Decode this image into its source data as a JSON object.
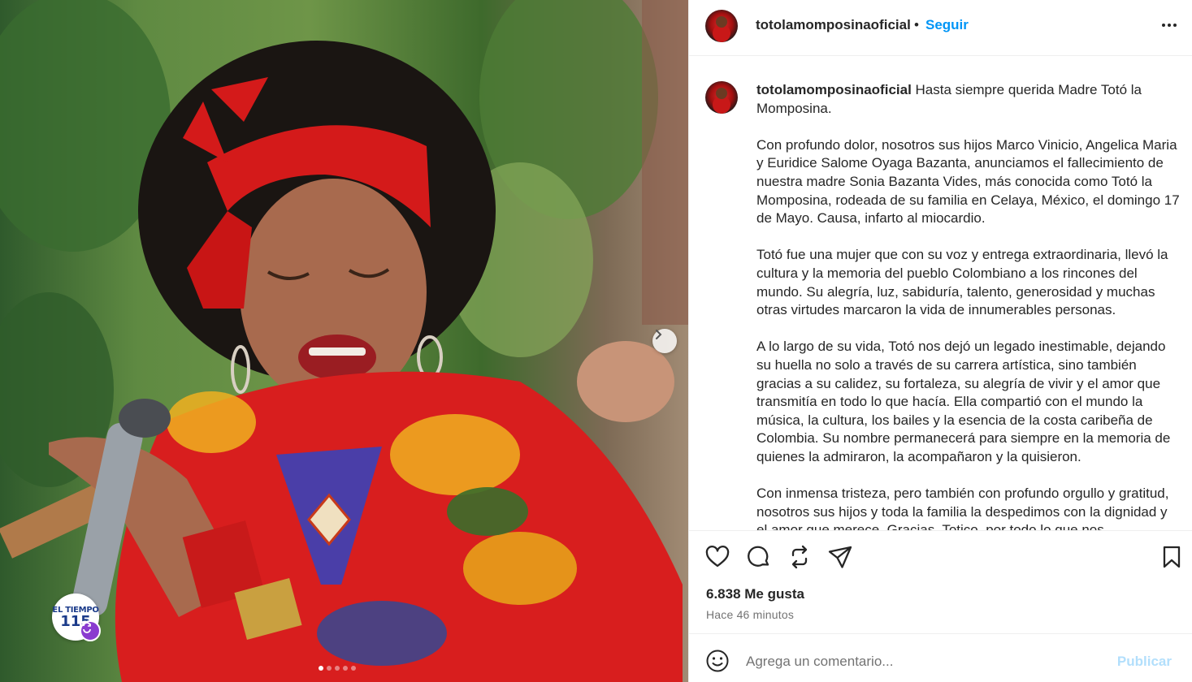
{
  "post": {
    "username": "totolamomposinaoficial",
    "bullet": "•",
    "follow_label": "Seguir",
    "more_icon": "more-options-icon",
    "caption": {
      "username": "totolamomposinaoficial",
      "first_line": "Hasta siempre querida Madre Totó la Momposina.",
      "paragraphs": [
        "Con profundo dolor, nosotros sus hijos Marco Vinicio, Angelica Maria y Euridice Salome Oyaga Bazanta, anunciamos el fallecimiento de nuestra madre Sonia Bazanta Vides, más conocida como Totó la Momposina, rodeada de su familia en Celaya, México, el domingo 17 de Mayo. Causa, infarto al miocardio.",
        "Totó fue una mujer que con su voz y entrega extraordinaria, llevó la cultura y la memoria del pueblo Colombiano a los rincones del mundo. Su alegría, luz, sabiduría, talento, generosidad y muchas otras virtudes marcaron la vida de innumerables personas.",
        "A lo largo de su vida, Totó nos dejó un legado inestimable, dejando su huella no solo a través de su carrera artística, sino también gracias a su calidez, su fortaleza, su alegría de vivir y el amor que transmitía en todo lo que hacía. Ella compartió con el mundo la música, la cultura, los bailes y la esencia de la costa caribeña de Colombia. Su nombre permanecerá para siempre en la memoria de quienes la admiraron, la acompañaron y la quisieron.",
        "Con inmensa tristeza, pero también con profundo orgullo y gratitud, nosotros sus hijos y toda la familia la despedimos con la dignidad y el amor que merece. Gracias, Totico, por todo lo que nos"
      ]
    },
    "likes": "6.838 Me gusta",
    "time_ago": "Hace 46 minutos",
    "comment_placeholder": "Agrega un comentario...",
    "publish_label": "Publicar"
  },
  "media": {
    "badge_line1": "EL TIEMPO",
    "badge_line2": "115",
    "carousel_total": 5,
    "carousel_active": 1
  },
  "icons": [
    "like-icon",
    "comment-icon",
    "repost-icon",
    "share-icon",
    "save-icon",
    "emoji-icon",
    "chevron-right-icon"
  ],
  "colors": {
    "link_blue": "#0095f6",
    "publish_disabled": "#b2dffc",
    "muted": "#737373"
  }
}
